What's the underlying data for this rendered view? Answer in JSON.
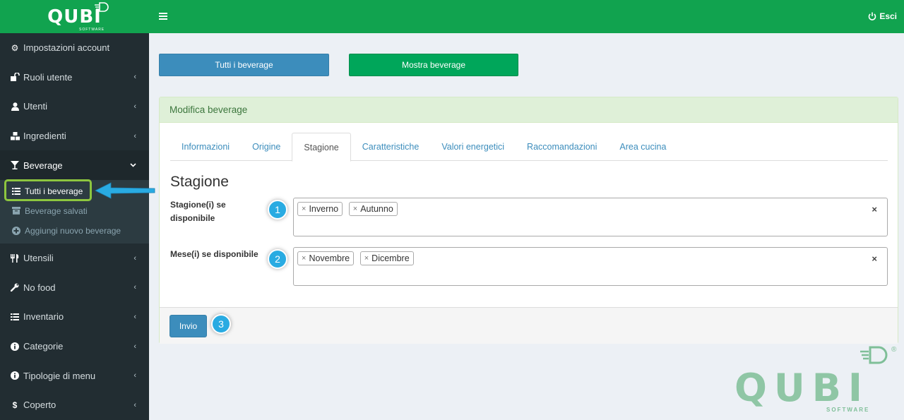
{
  "brand": {
    "logo": "QUBI",
    "logo_sub": "SOFTWARE",
    "watermark": "QUBI",
    "watermark_sub": "SOFTWARE",
    "registered": "®"
  },
  "topbar": {
    "logout_label": "Esci"
  },
  "sidebar": {
    "items": [
      {
        "label": "Impostazioni account",
        "icon": "gear-icon"
      },
      {
        "label": "Ruoli utente",
        "icon": "unlock-icon"
      },
      {
        "label": "Utenti",
        "icon": "user-icon"
      },
      {
        "label": "Ingredienti",
        "icon": "cubes-icon"
      },
      {
        "label": "Beverage",
        "icon": "glass-icon"
      },
      {
        "label": "Utensili",
        "icon": "cutlery-icon"
      },
      {
        "label": "No food",
        "icon": "wrench-icon"
      },
      {
        "label": "Inventario",
        "icon": "list-icon"
      },
      {
        "label": "Categorie",
        "icon": "info-icon"
      },
      {
        "label": "Tipologie di menu",
        "icon": "info-icon"
      },
      {
        "label": "Coperto",
        "icon": "dollar-icon"
      }
    ],
    "beverage_sub": [
      {
        "label": "Tutti i beverage",
        "icon": "list-icon"
      },
      {
        "label": "Beverage salvati",
        "icon": "archive-icon"
      },
      {
        "label": "Aggiungi nuovo beverage",
        "icon": "plus-circle-icon"
      }
    ]
  },
  "actions": {
    "all_label": "Tutti i beverage",
    "show_label": "Mostra beverage"
  },
  "panel": {
    "title": "Modifica beverage",
    "tabs": [
      "Informazioni",
      "Origine",
      "Stagione",
      "Caratteristiche",
      "Valori energetici",
      "Raccomandazioni",
      "Area cucina"
    ],
    "active_tab": "Stagione",
    "section_title": "Stagione",
    "fields": [
      {
        "label": "Stagione(i) se disponibile",
        "tags": [
          "Inverno",
          "Autunno"
        ],
        "badge": "1"
      },
      {
        "label": "Mese(i) se disponibile",
        "tags": [
          "Novembre",
          "Dicembre"
        ],
        "badge": "2"
      }
    ],
    "submit_label": "Invio",
    "submit_badge": "3"
  },
  "colors": {
    "brand_green": "#11a34f",
    "primary_blue": "#3c8dbc",
    "success_green": "#00a65a",
    "sidebar_bg": "#222d32",
    "badge_blue": "#29abe2",
    "highlight": "#8dc63f"
  }
}
